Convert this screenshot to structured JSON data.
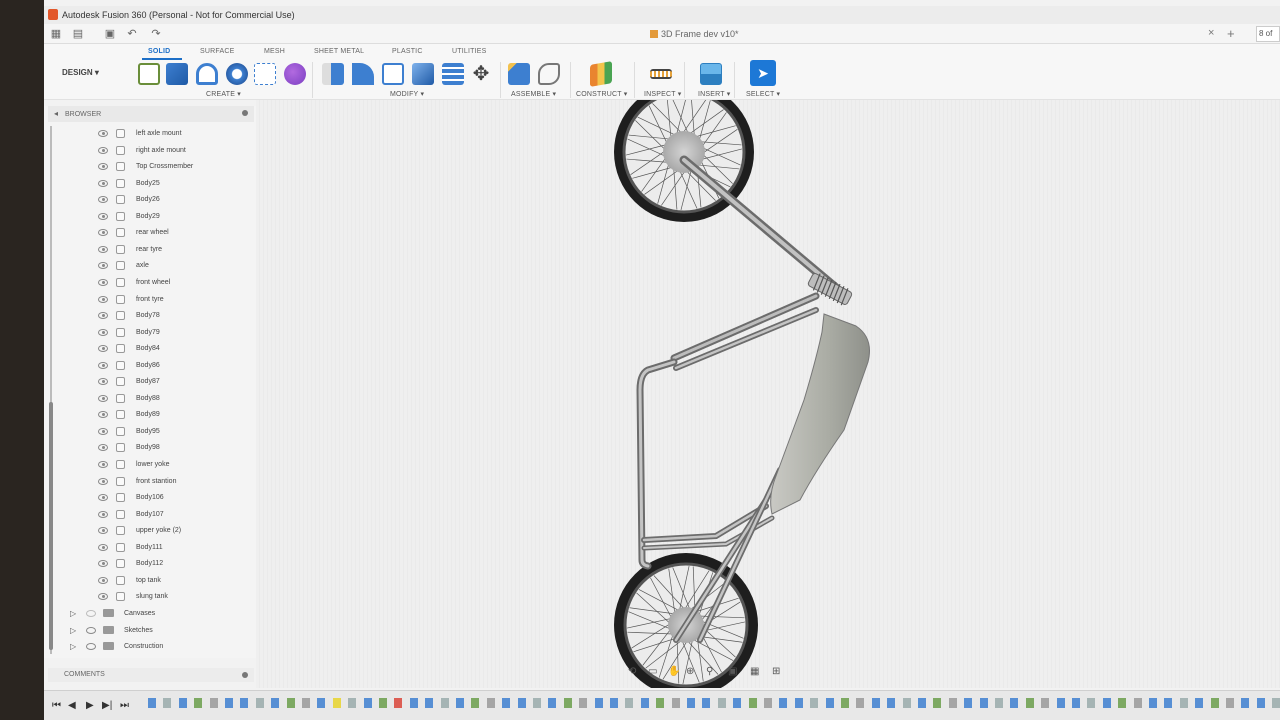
{
  "window": {
    "app_title": "Autodesk Fusion 360 (Personal - Not for Commercial Use)"
  },
  "tabbar": {
    "document_title": "3D Frame dev v10*",
    "close_symbol": "×",
    "new_tab_symbol": "+",
    "job_status": "8 of"
  },
  "toolbar": {
    "workspace": "DESIGN ▾",
    "tabs": [
      "SOLID",
      "SURFACE",
      "MESH",
      "SHEET METAL",
      "PLASTIC",
      "UTILITIES"
    ],
    "groups": {
      "create": "CREATE ▾",
      "modify": "MODIFY ▾",
      "assemble": "ASSEMBLE ▾",
      "construct": "CONSTRUCT ▾",
      "inspect": "INSPECT ▾",
      "insert": "INSERT ▾",
      "select": "SELECT ▾"
    },
    "accent_color": "#1d6fc7"
  },
  "browser": {
    "title": "BROWSER",
    "bodies": [
      "left axle mount",
      "right axle mount",
      "Top Crossmember",
      "Body25",
      "Body26",
      "Body29",
      "rear wheel",
      "rear tyre",
      "axle",
      "front wheel",
      "front tyre",
      "Body78",
      "Body79",
      "Body84",
      "Body86",
      "Body87",
      "Body88",
      "Body89",
      "Body95",
      "Body98",
      "lower yoke",
      "front stantion",
      "Body106",
      "Body107",
      "upper yoke (2)",
      "Body111",
      "Body112",
      "top tank",
      "slung tank"
    ],
    "folders": [
      "Canvases",
      "Sketches",
      "Construction"
    ]
  },
  "comments": {
    "title": "COMMENTS"
  }
}
